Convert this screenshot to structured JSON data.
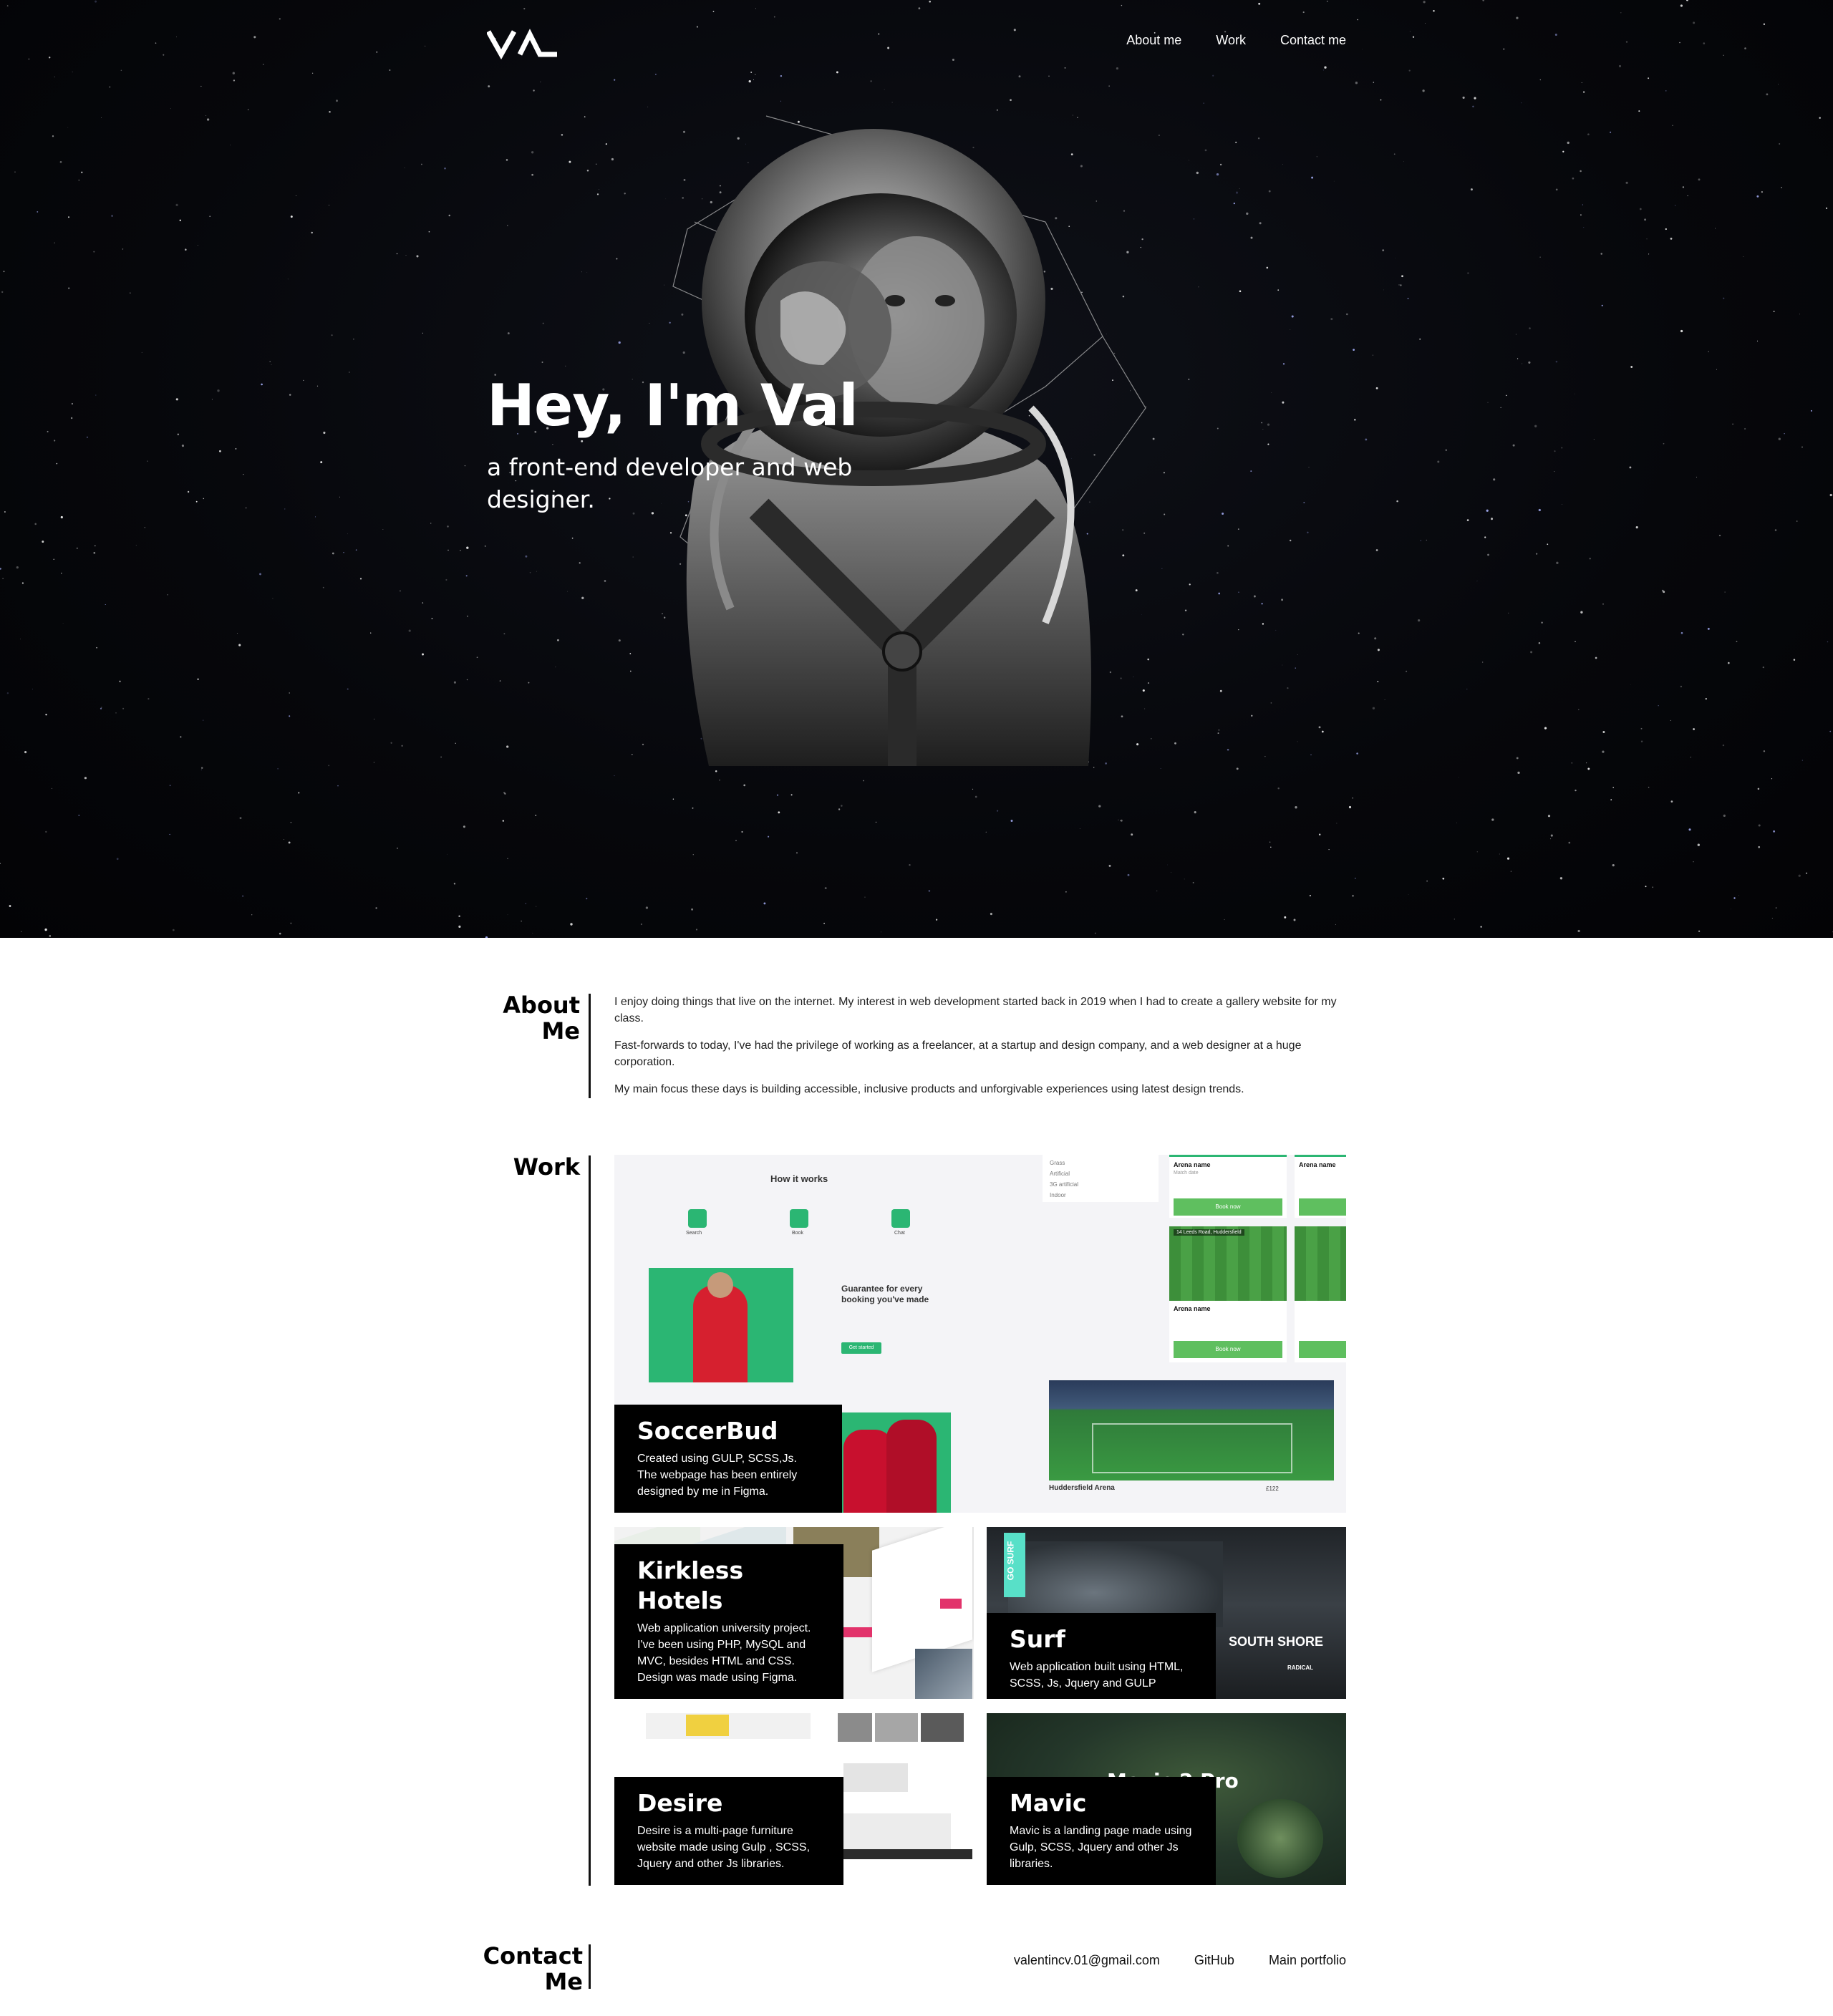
{
  "nav": {
    "logo_text": "VAL",
    "links": [
      "About me",
      "Work",
      "Contact me"
    ]
  },
  "hero": {
    "title": "Hey, I'm Val",
    "subtitle": "a front-end developer and web designer."
  },
  "about": {
    "heading": "About Me",
    "paragraphs": [
      "I enjoy doing things that live on the internet. My interest in web development started back in 2019 when I had to create a gallery website for my class.",
      "Fast-forwards to today, I've had the privilege of working as a freelancer, at a startup and design company, and a web designer at a huge corporation.",
      "My main focus these days is building accessible, inclusive products and unforgivable experiences using latest design trends."
    ]
  },
  "work": {
    "heading": "Work",
    "projects": [
      {
        "title": "SoccerBud",
        "desc": "Created using GULP, SCSS,Js. The webpage has been entirely designed by me in Figma."
      },
      {
        "title": "Kirkless Hotels",
        "desc": "Web application university project. I've been using PHP, MySQL and MVC, besides HTML and CSS. Design was made using Figma."
      },
      {
        "title": "Surf",
        "desc": "Web application built using HTML, SCSS, Js, Jquery and GULP"
      },
      {
        "title": "Desire",
        "desc": "Desire is a multi-page furniture website made using Gulp , SCSS, Jquery and other Js libraries."
      },
      {
        "title": "Mavic",
        "desc": "Mavic is a landing page made using Gulp, SCSS, Jquery and other Js libraries."
      }
    ],
    "soccerbud_preview": {
      "how_it_works": "How it works",
      "steps": [
        "Search",
        "Book",
        "Chat"
      ],
      "guarantee": "Guarantee for every booking you've made",
      "get_started": "Get started",
      "filters": [
        "Grass",
        "Artificial",
        "3G artificial",
        "Indoor"
      ],
      "arena_name": "Arena name",
      "match_date": "Match date",
      "book_now": "Book now",
      "address": "14 Leeds Road, Huddersfield",
      "arena_title": "Huddersfield Arena",
      "price": "£122"
    },
    "surf_preview": {
      "badge": "GO SURF",
      "headline": "SOUTH SHORE",
      "sub": "RADICAL"
    },
    "mavic_preview": {
      "headline": "Mavic 2 Pro"
    },
    "colors": {
      "accent_green": "#2bb673",
      "caption_bg": "#000000"
    }
  },
  "contact": {
    "heading": "Contact Me",
    "links": [
      "valentincv.01@gmail.com",
      "GitHub",
      "Main portfolio"
    ]
  }
}
